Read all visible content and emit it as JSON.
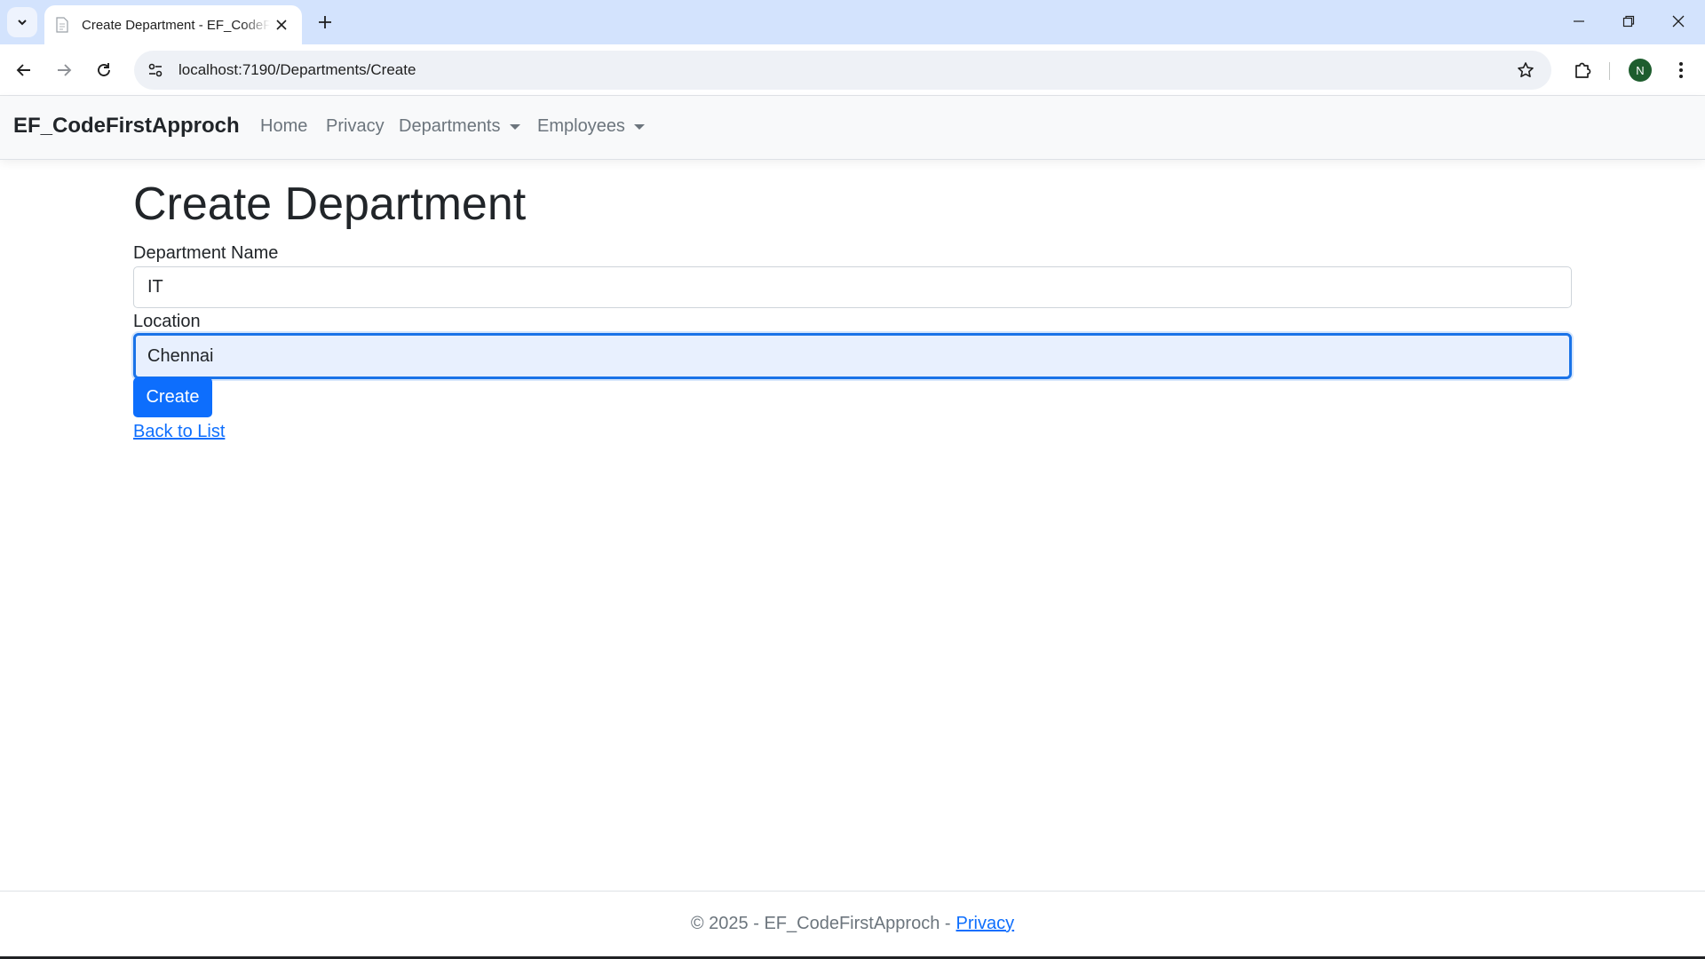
{
  "browser": {
    "tab_title": "Create Department - EF_CodeFirstApproch",
    "url": "localhost:7190/Departments/Create",
    "profile_initial": "N"
  },
  "navbar": {
    "brand": "EF_CodeFirstApproch",
    "links": [
      {
        "label": "Home"
      },
      {
        "label": "Privacy"
      },
      {
        "label": "Departments"
      },
      {
        "label": "Employees"
      }
    ]
  },
  "form": {
    "title": "Create Department",
    "department_name_label": "Department Name",
    "department_name_value": "IT",
    "location_label": "Location",
    "location_value": "Chennai",
    "submit_label": "Create",
    "back_link": "Back to List"
  },
  "footer": {
    "text": "© 2025 - EF_CodeFirstApproch -",
    "link": "Privacy"
  },
  "colors": {
    "tabstrip": "#d3e3fd",
    "primary": "#0d6efd",
    "focus_border": "#1a73e8",
    "focus_bg": "#e8f0fe",
    "profile": "#1e5d2e"
  },
  "icons": {
    "tab_list": "chevron-down-icon",
    "favicon": "page-icon",
    "tab_close": "close-icon",
    "new_tab": "plus-icon",
    "minimize": "minimize-icon",
    "restore": "restore-icon",
    "close_window": "close-icon",
    "back": "arrow-left-icon",
    "forward": "arrow-right-icon",
    "reload": "reload-icon",
    "site_info": "tune-icon",
    "bookmark": "star-icon",
    "extensions": "puzzle-icon",
    "menu": "more-vert-icon"
  }
}
